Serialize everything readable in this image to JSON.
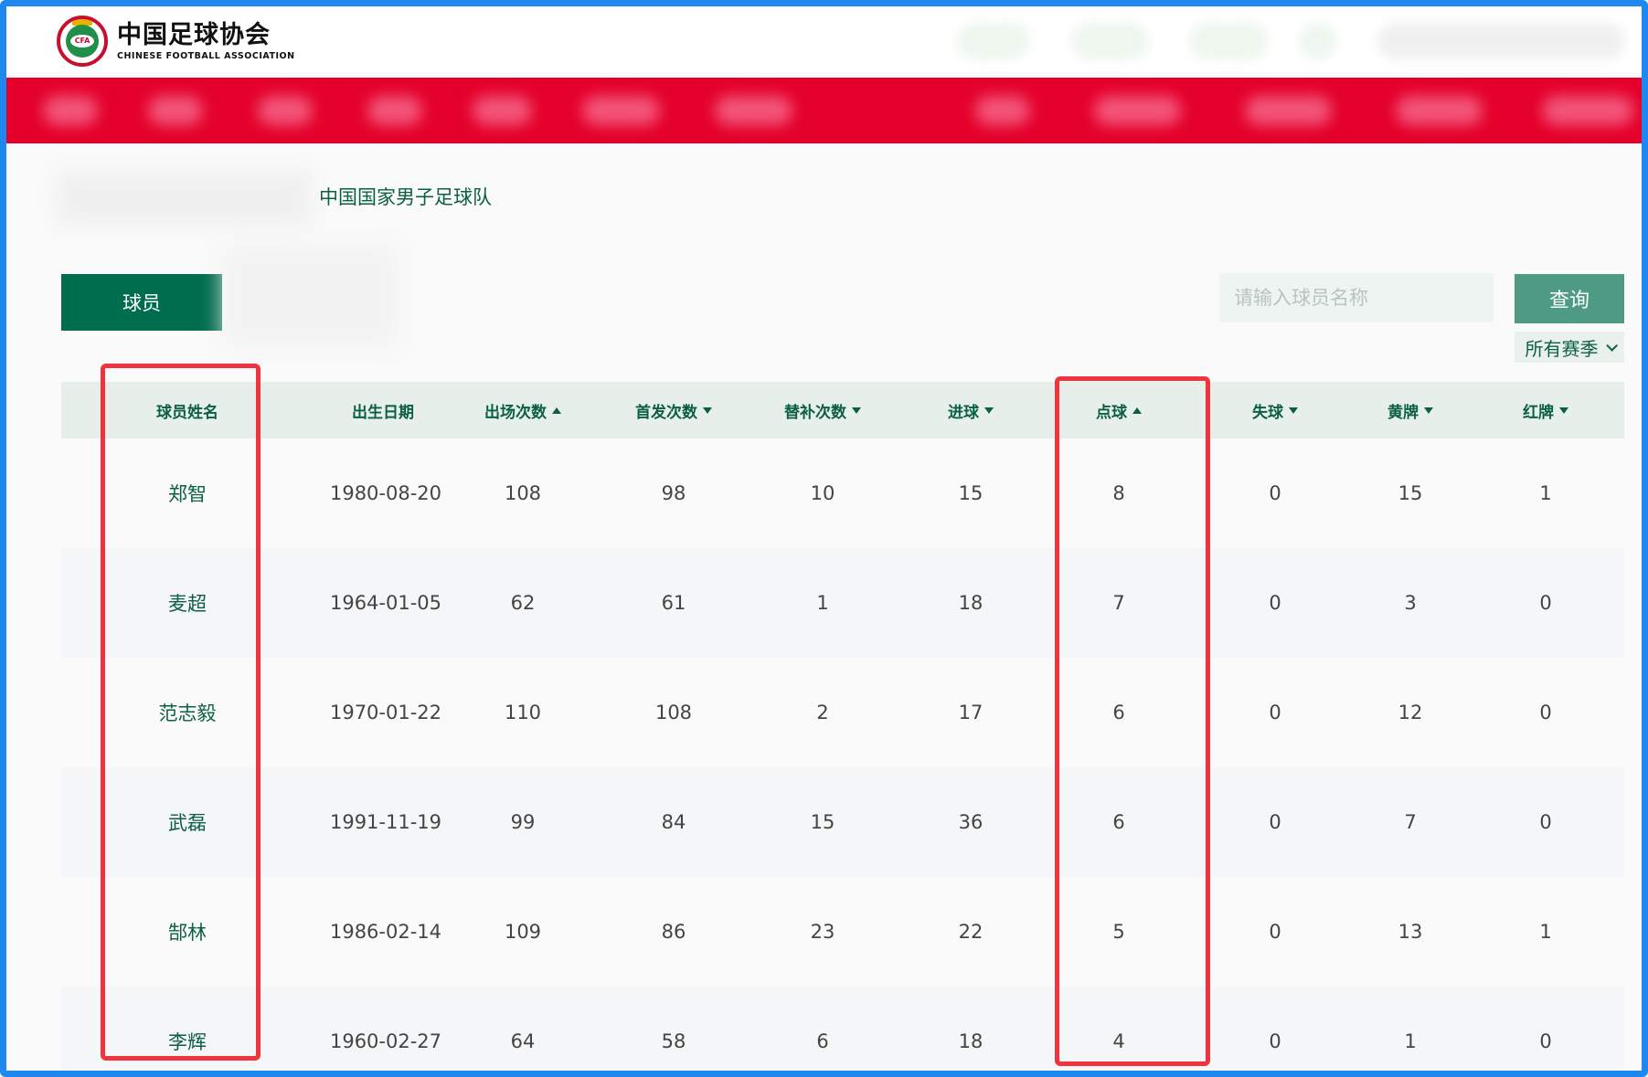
{
  "header": {
    "logo_cn": "中国足球协会",
    "logo_en": "CHINESE FOOTBALL ASSOCIATION",
    "logo_badge": "CFA"
  },
  "breadcrumb": {
    "current": "中国国家男子足球队"
  },
  "tabs": {
    "active_label": "球员"
  },
  "search": {
    "placeholder": "请输入球员名称",
    "button_label": "查询"
  },
  "season_filter": {
    "selected": "所有赛季"
  },
  "colors": {
    "primary_green": "#006d4f",
    "nav_red": "#e4002b",
    "highlight_red": "#f0333c"
  },
  "table": {
    "columns": [
      {
        "key": "name",
        "label": "球员姓名",
        "sort": ""
      },
      {
        "key": "birth",
        "label": "出生日期",
        "sort": ""
      },
      {
        "key": "apps",
        "label": "出场次数",
        "sort": "asc"
      },
      {
        "key": "starts",
        "label": "首发次数",
        "sort": "desc"
      },
      {
        "key": "subs",
        "label": "替补次数",
        "sort": "desc"
      },
      {
        "key": "goals",
        "label": "进球",
        "sort": "desc"
      },
      {
        "key": "pens",
        "label": "点球",
        "sort": "asc"
      },
      {
        "key": "conceded",
        "label": "失球",
        "sort": "desc"
      },
      {
        "key": "yellow",
        "label": "黄牌",
        "sort": "desc"
      },
      {
        "key": "red",
        "label": "红牌",
        "sort": "desc"
      }
    ],
    "rows": [
      {
        "name": "郑智",
        "birth": "1980-08-20",
        "apps": "108",
        "starts": "98",
        "subs": "10",
        "goals": "15",
        "pens": "8",
        "conceded": "0",
        "yellow": "15",
        "red": "1"
      },
      {
        "name": "麦超",
        "birth": "1964-01-05",
        "apps": "62",
        "starts": "61",
        "subs": "1",
        "goals": "18",
        "pens": "7",
        "conceded": "0",
        "yellow": "3",
        "red": "0"
      },
      {
        "name": "范志毅",
        "birth": "1970-01-22",
        "apps": "110",
        "starts": "108",
        "subs": "2",
        "goals": "17",
        "pens": "6",
        "conceded": "0",
        "yellow": "12",
        "red": "0"
      },
      {
        "name": "武磊",
        "birth": "1991-11-19",
        "apps": "99",
        "starts": "84",
        "subs": "15",
        "goals": "36",
        "pens": "6",
        "conceded": "0",
        "yellow": "7",
        "red": "0"
      },
      {
        "name": "郜林",
        "birth": "1986-02-14",
        "apps": "109",
        "starts": "86",
        "subs": "23",
        "goals": "22",
        "pens": "5",
        "conceded": "0",
        "yellow": "13",
        "red": "1"
      },
      {
        "name": "李辉",
        "birth": "1960-02-27",
        "apps": "64",
        "starts": "58",
        "subs": "6",
        "goals": "18",
        "pens": "4",
        "conceded": "0",
        "yellow": "1",
        "red": "0"
      }
    ]
  }
}
